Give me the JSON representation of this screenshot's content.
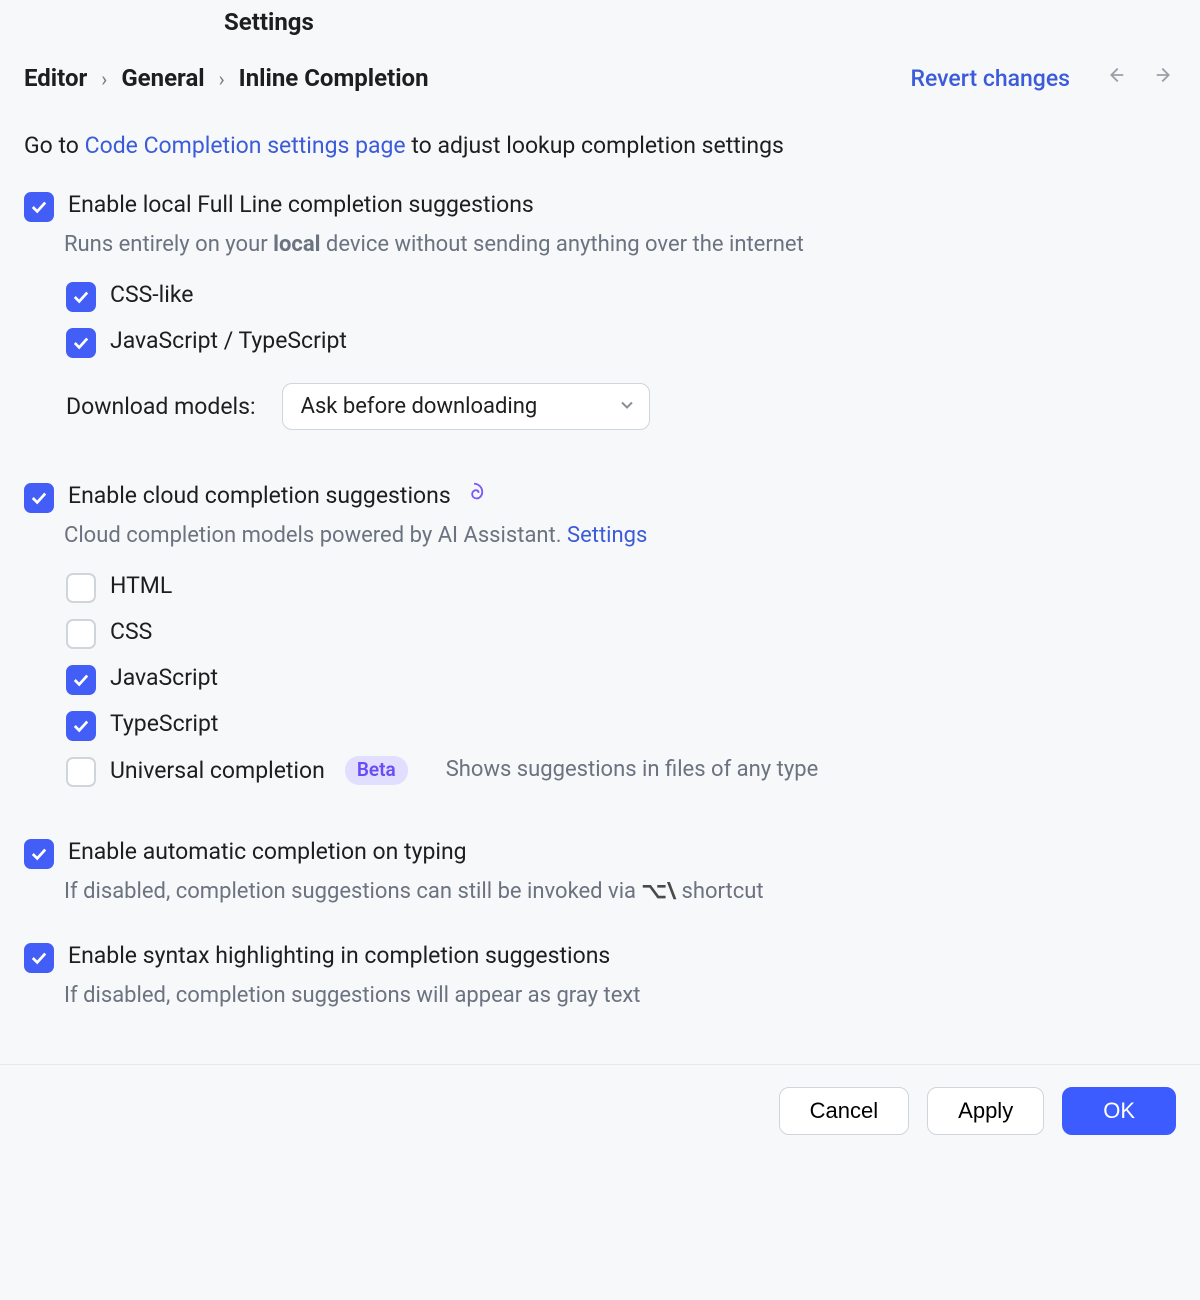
{
  "title": "Settings",
  "breadcrumb": {
    "item1": "Editor",
    "item2": "General",
    "item3": "Inline Completion"
  },
  "revert": "Revert changes",
  "intro_prefix": "Go to ",
  "intro_link": "Code Completion settings page",
  "intro_suffix": " to adjust lookup completion settings",
  "local": {
    "label": "Enable local Full Line completion suggestions",
    "desc_pre": "Runs entirely on your ",
    "desc_bold": "local",
    "desc_post": " device without sending anything over the internet",
    "css": "CSS-like",
    "jsts": "JavaScript / TypeScript",
    "download_label": "Download models:",
    "download_value": "Ask before downloading"
  },
  "cloud": {
    "label": "Enable cloud completion suggestions",
    "desc_pre": "Cloud completion models powered by AI Assistant. ",
    "desc_link": "Settings",
    "html": "HTML",
    "css": "CSS",
    "js": "JavaScript",
    "ts": "TypeScript",
    "universal": "Universal completion",
    "beta": "Beta",
    "universal_hint": "Shows suggestions in files of any type"
  },
  "auto": {
    "label": "Enable automatic completion on typing",
    "desc_pre": "If disabled, completion suggestions can still be invoked via ",
    "shortcut": "⌥\\",
    "desc_post": " shortcut"
  },
  "syntax": {
    "label": "Enable syntax highlighting in completion suggestions",
    "desc": "If disabled, completion suggestions will appear as gray text"
  },
  "footer": {
    "cancel": "Cancel",
    "apply": "Apply",
    "ok": "OK"
  }
}
